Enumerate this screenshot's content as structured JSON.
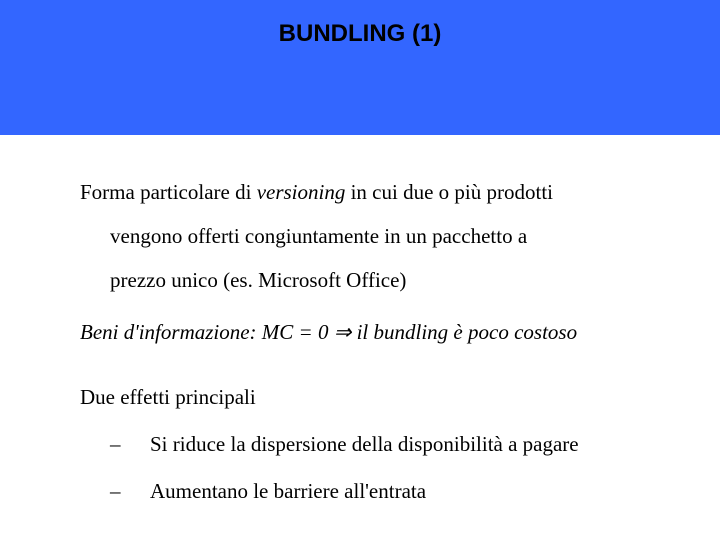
{
  "header": {
    "title": "BUNDLING (1)"
  },
  "body": {
    "p1_a": "Forma particolare di ",
    "p1_b": "versioning",
    "p1_c": " in cui due o più prodotti",
    "p1_line2": "vengono offerti congiuntamente in un pacchetto a",
    "p1_line3": "prezzo unico (es. Microsoft Office)",
    "p2_a": "Beni d'informazione: MC = 0 ",
    "p2_arrow": "⇒",
    "p2_b": " il bundling è poco costoso",
    "p3": "Due effetti principali",
    "bullets": [
      {
        "dash": "–",
        "text": "Si riduce la dispersione della disponibilità a pagare"
      },
      {
        "dash": "–",
        "text": "Aumentano le barriere all'entrata"
      }
    ]
  }
}
